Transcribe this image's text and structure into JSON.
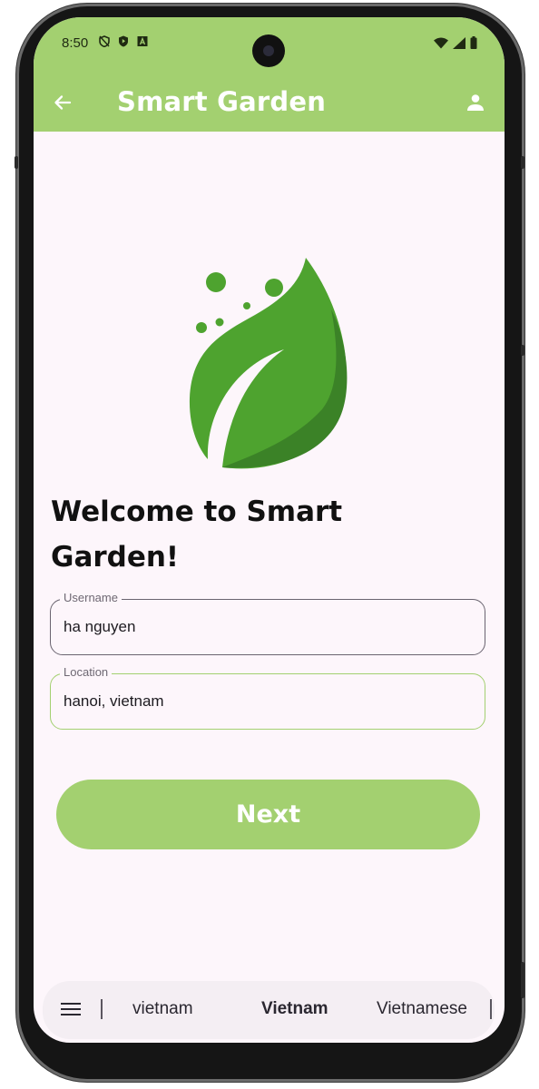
{
  "status_bar": {
    "time": "8:50",
    "left_icons": [
      "shield-off-icon",
      "play-protect-icon",
      "a-box-icon"
    ],
    "right_icons": [
      "wifi-icon",
      "signal-icon",
      "battery-icon"
    ]
  },
  "app_bar": {
    "title": "Smart Garden",
    "back_icon": "arrow-left-icon",
    "profile_icon": "person-icon",
    "color": "#a3d070"
  },
  "welcome": {
    "heading_line1": "Welcome to Smart",
    "heading_line2": "Garden!"
  },
  "form": {
    "username": {
      "label": "Username",
      "value": "ha nguyen"
    },
    "location": {
      "label": "Location",
      "value": "hanoi, vietnam"
    }
  },
  "next_button": {
    "label": "Next",
    "color": "#a3d070"
  },
  "keyboard": {
    "menu_icon": "hamburger-icon",
    "suggestions": [
      "vietnam",
      "Vietnam",
      "Vietnamese"
    ]
  },
  "colors": {
    "accent": "#a3d070",
    "leaf_light": "#4ea32f",
    "leaf_dark": "#3b8227",
    "background": "#fdf6fb"
  }
}
